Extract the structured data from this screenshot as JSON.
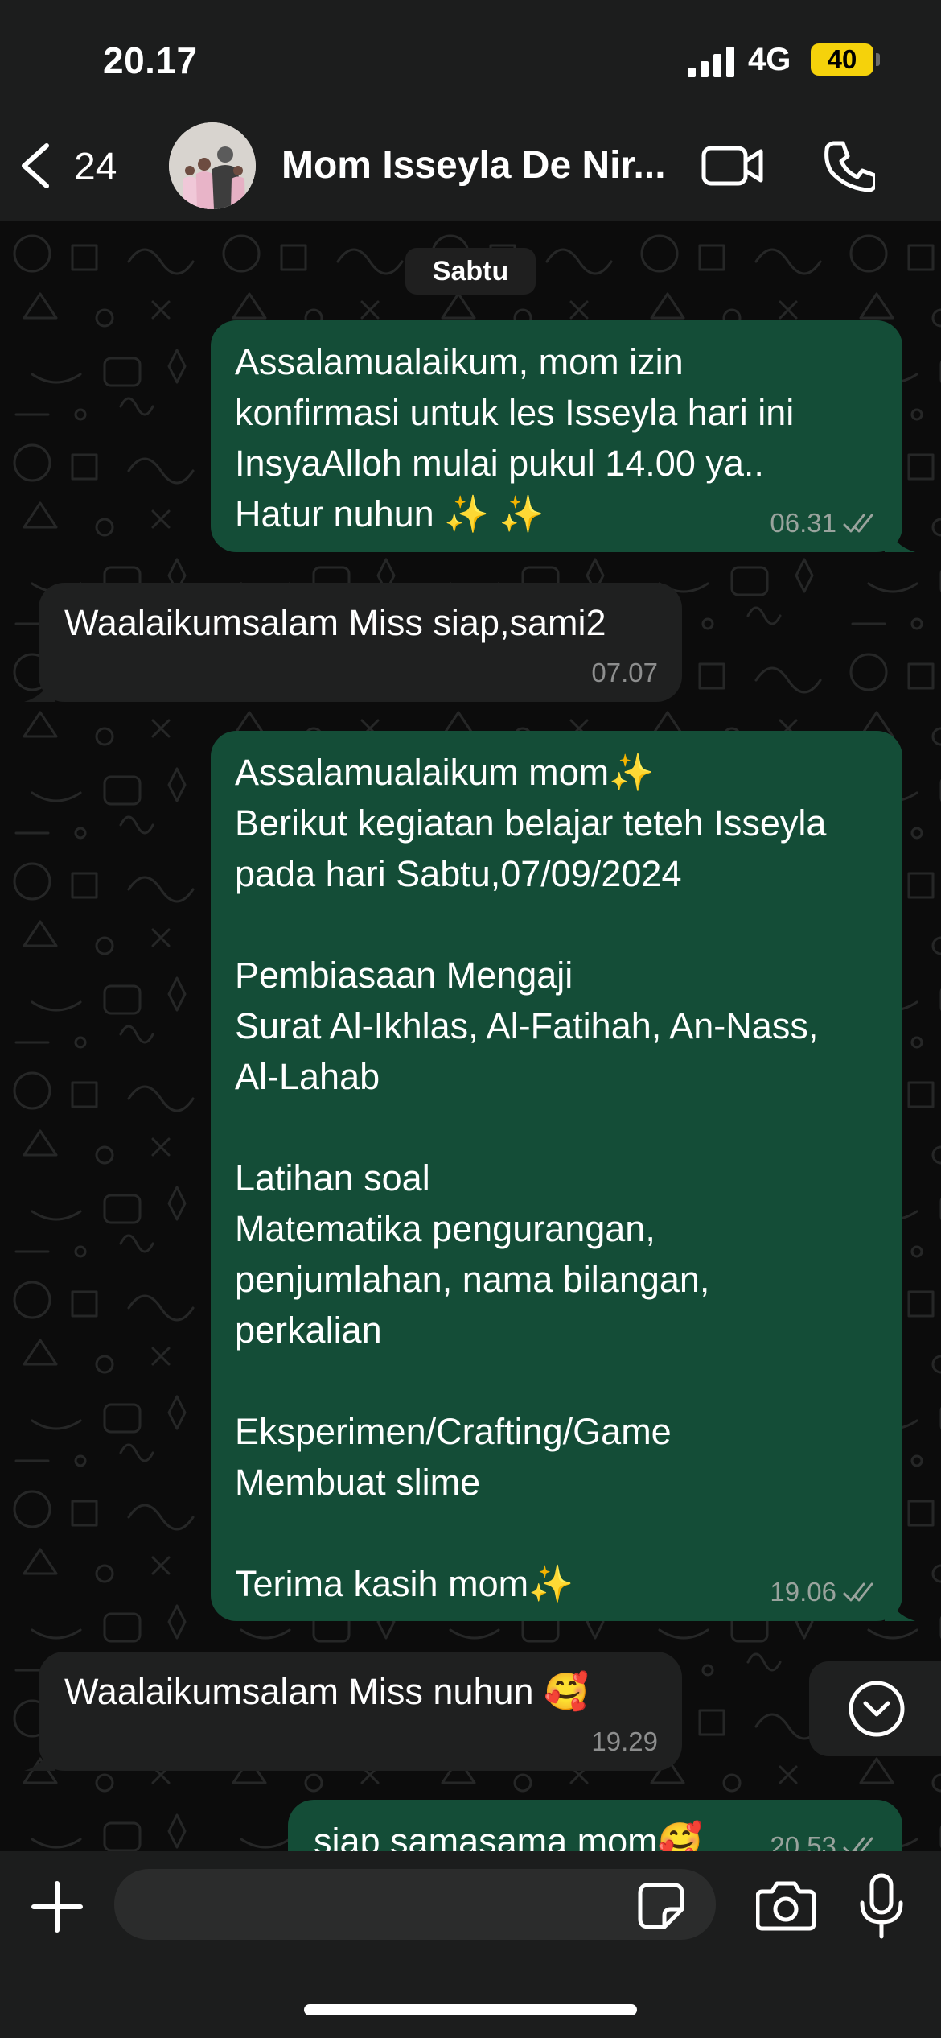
{
  "status_bar": {
    "time": "20.17",
    "network": "4G",
    "battery": "40"
  },
  "header": {
    "unread_count": "24",
    "contact_name": "Mom Isseyla De Nir...",
    "avatar_icon": "contact-photo",
    "video_icon": "video-camera-icon",
    "call_icon": "phone-icon"
  },
  "chat": {
    "date_divider": "Sabtu",
    "messages": [
      {
        "direction": "outgoing",
        "text": "Assalamualaikum, mom izin\nkonfirmasi untuk les Isseyla hari ini\nInsyaAlloh mulai pukul 14.00 ya..\nHatur nuhun ✨ ✨",
        "time": "06.31",
        "status": "read"
      },
      {
        "direction": "incoming",
        "text": "Waalaikumsalam Miss siap,sami2",
        "time": "07.07"
      },
      {
        "direction": "outgoing",
        "text": "Assalamualaikum mom✨\nBerikut kegiatan belajar teteh Isseyla\npada hari Sabtu,07/09/2024\n\nPembiasaan Mengaji\nSurat Al-Ikhlas, Al-Fatihah, An-Nass,\nAl-Lahab\n\nLatihan soal\nMatematika pengurangan,\npenjumlahan, nama bilangan,\nperkalian\n\nEksperimen/Crafting/Game\nMembuat slime\n\nTerima kasih mom✨",
        "time": "19.06",
        "status": "read"
      },
      {
        "direction": "incoming",
        "text": "Waalaikumsalam Miss nuhun 🥰",
        "time": "19.29"
      },
      {
        "direction": "outgoing",
        "text": "siap samasama mom🥰",
        "time": "20.53",
        "status": "read"
      }
    ]
  },
  "input_bar": {
    "message_value": "",
    "attach_icon": "plus-icon",
    "sticker_icon": "sticker-icon",
    "camera_icon": "camera-icon",
    "mic_icon": "microphone-icon"
  },
  "colors": {
    "outgoing_bubble": "#144d37",
    "incoming_bubble": "#1f2020",
    "battery": "#f5d20b",
    "bar_background": "#1c1d1d"
  }
}
